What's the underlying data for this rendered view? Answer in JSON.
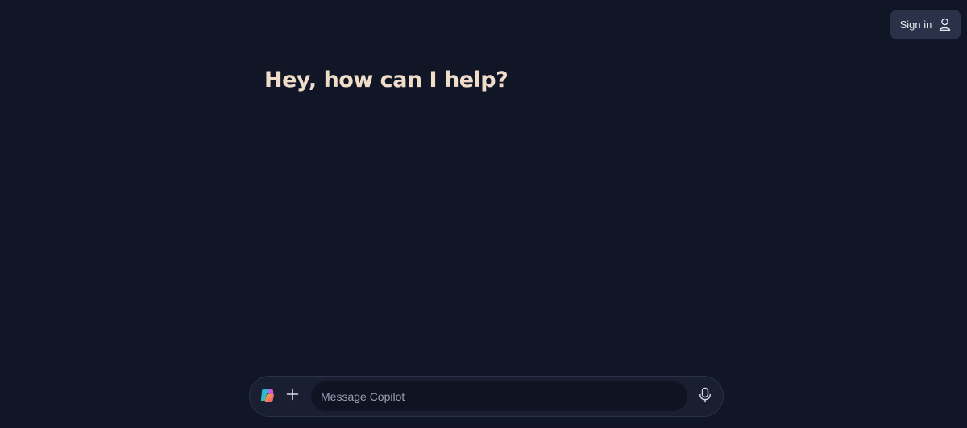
{
  "header": {
    "signin_label": "Sign in",
    "signin_icon": "user-icon"
  },
  "main": {
    "greeting": "Hey, how can I help?"
  },
  "composer": {
    "logo_icon": "copilot-logo-icon",
    "add_icon": "plus-icon",
    "placeholder": "Message Copilot",
    "value": "",
    "mic_icon": "microphone-icon"
  },
  "colors": {
    "background": "#111627",
    "greeting": "#efdcc9",
    "signin_bg": "#2a3148",
    "composer_bg": "#191e30",
    "input_bg": "#0f1322"
  }
}
